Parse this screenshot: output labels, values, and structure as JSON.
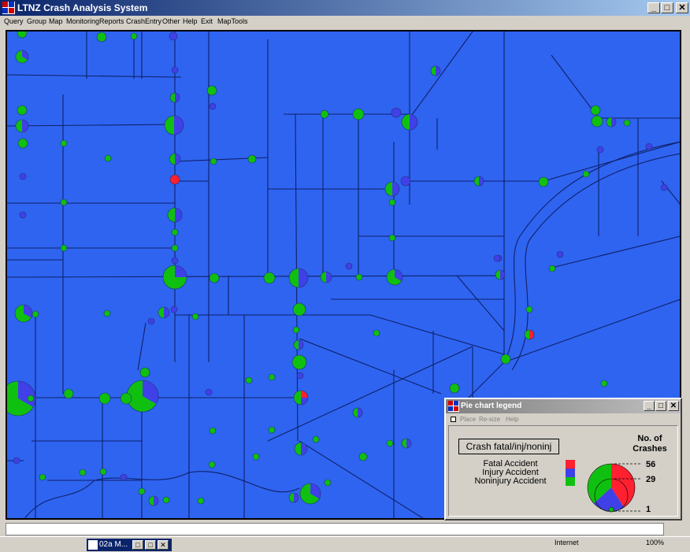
{
  "window": {
    "title": "LTNZ Crash Analysis System",
    "minimize_label": "_",
    "maximize_label": "□",
    "close_label": "✕"
  },
  "menu": [
    {
      "label": "Query"
    },
    {
      "label": "Group"
    },
    {
      "label": "Map"
    },
    {
      "label": "Monitoring"
    },
    {
      "label": "Reports"
    },
    {
      "label": "CrashEntry"
    },
    {
      "label": "Other"
    },
    {
      "label": "Help"
    },
    {
      "label": "Exit"
    },
    {
      "label": "MapTools"
    }
  ],
  "colors": {
    "map_background": "#2e64f0",
    "road": "#10206a",
    "fatal": "#ff2030",
    "injury": "#4040e8",
    "noninjury": "#10c010",
    "title_gradient_start": "#0a246a",
    "title_gradient_end": "#a6caf0"
  },
  "legend": {
    "title": "Pie chart legend",
    "menu": [
      "Place",
      "Re-size",
      "Help"
    ],
    "button_label": "Crash fatal/inj/noninj",
    "categories": [
      {
        "label": "Fatal Accident",
        "color": "#ff2030"
      },
      {
        "label": "Injury Accident",
        "color": "#4040e8"
      },
      {
        "label": "Noninjury Accident",
        "color": "#10c010"
      }
    ],
    "size_heading": "No. of Crashes",
    "size_values": [
      "56",
      "29",
      "1"
    ]
  },
  "taskbar": {
    "item_label": "02a M...",
    "tray_left": "Internet",
    "tray_right": "100%"
  },
  "icons": [
    "app-icon",
    "legend-window-icon",
    "system-menu-icon",
    "taskbar-app-icon"
  ]
}
